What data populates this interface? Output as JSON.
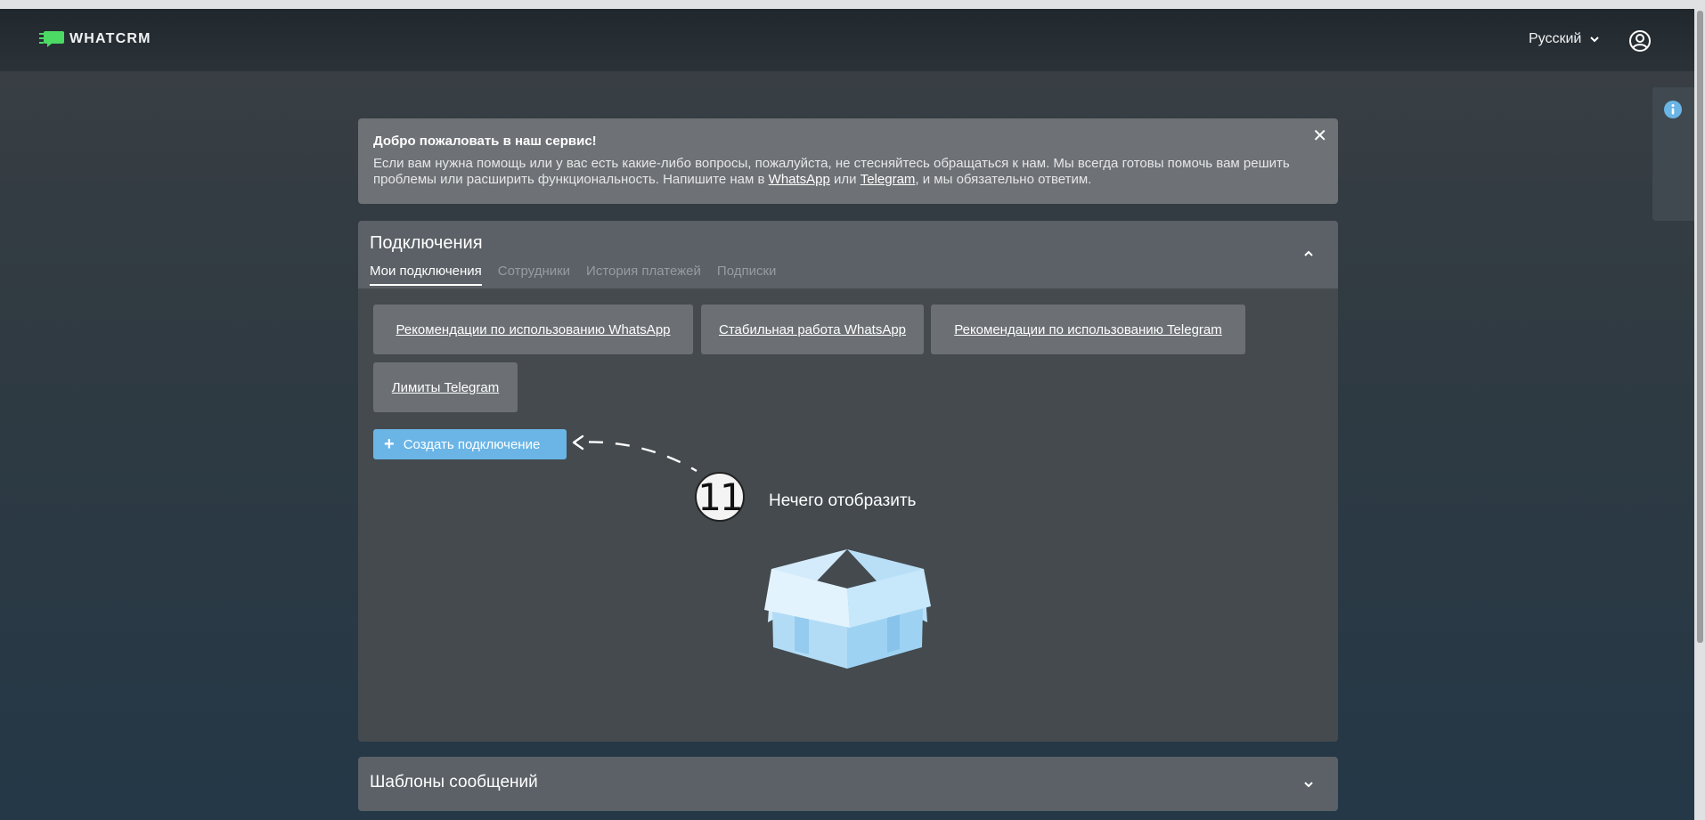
{
  "header": {
    "logo_text": "WHATCRM",
    "language": "Русский"
  },
  "welcome": {
    "title": "Добро пожаловать в наш сервис!",
    "text_line1": "Если вам нужна помощь или у вас есть какие-либо вопросы, пожалуйста, не стесняйтесь обращаться к нам. Мы всегда готовы помочь вам решить проблемы или расширить функциональность. Напишите нам в ",
    "link_whatsapp": "WhatsApp",
    "text_or": " или ",
    "link_telegram": "Telegram",
    "text_end": ", и мы обязательно ответим.",
    "close_symbol": "✕"
  },
  "connections": {
    "title": "Подключения",
    "tabs": [
      {
        "label": "Мои подключения",
        "active": true
      },
      {
        "label": "Сотрудники",
        "active": false
      },
      {
        "label": "История платежей",
        "active": false
      },
      {
        "label": "Подписки",
        "active": false
      }
    ],
    "guides": [
      "Рекомендации по использованию WhatsApp",
      "Стабильная работа WhatsApp",
      "Рекомендации по использованию Telegram",
      "Лимиты Telegram"
    ],
    "create_button": "Создать подключение",
    "step_number": "11",
    "empty_text": "Нечего отобразить"
  },
  "templates": {
    "title": "Шаблоны сообщений"
  },
  "colors": {
    "accent": "#6ab5e6",
    "logo_green": "#4cd964"
  }
}
